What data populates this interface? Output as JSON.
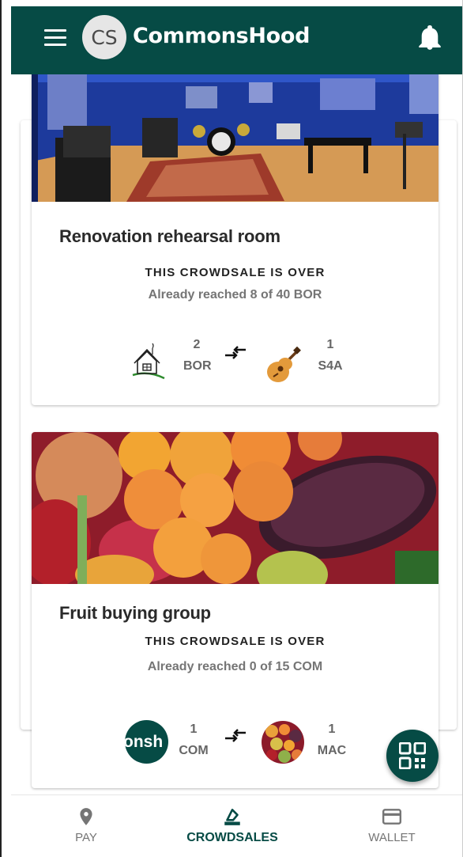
{
  "header": {
    "avatar_initials": "CS",
    "title": "CommonsHood"
  },
  "crowdsales": [
    {
      "title": "Renovation rehearsal room",
      "status": "THIS CROWDSALE IS OVER",
      "progress": "Already reached 8 of 40 BOR",
      "give": {
        "amount": "2",
        "symbol": "BOR"
      },
      "get": {
        "amount": "1",
        "symbol": "S4A"
      }
    },
    {
      "title": "Fruit buying group",
      "status": "THIS CROWDSALE IS OVER",
      "progress": "Already reached 0 of 15 COM",
      "give": {
        "amount": "1",
        "symbol": "COM",
        "logo_text": "onsh"
      },
      "get": {
        "amount": "1",
        "symbol": "MAC"
      }
    }
  ],
  "bottom_nav": {
    "pay": "PAY",
    "crowdsales": "CROWDSALES",
    "wallet": "WALLET",
    "active": "crowdsales"
  },
  "colors": {
    "primary": "#064b45",
    "text_muted": "#757575"
  },
  "icons": [
    "menu-icon",
    "bell-icon",
    "swap-icon",
    "qr-code-icon",
    "location-pin-icon",
    "crowdsale-icon",
    "wallet-icon"
  ]
}
